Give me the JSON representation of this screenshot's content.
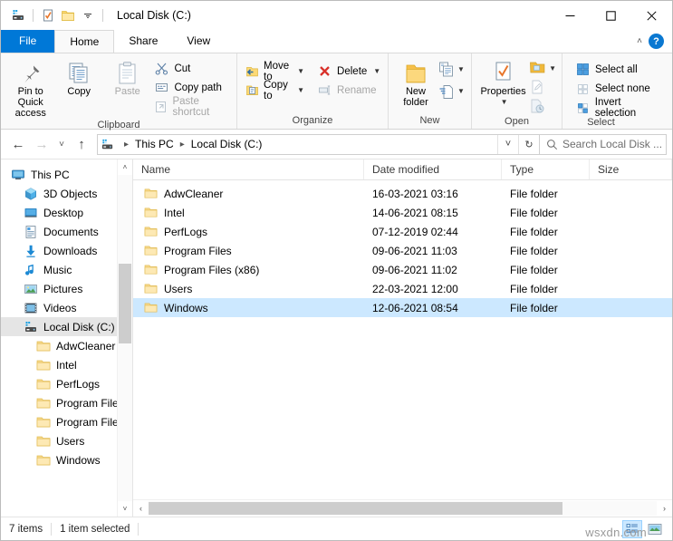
{
  "window": {
    "title": "Local Disk (C:)",
    "controls": {
      "minimize": "—",
      "maximize": "☐",
      "close": "✕"
    },
    "quick_access": [
      {
        "name": "drive-icon",
        "label": "Local Disk"
      },
      {
        "name": "properties-icon",
        "label": "Properties"
      },
      {
        "name": "new-folder-icon",
        "label": "New folder"
      },
      {
        "name": "chevron-down-icon",
        "label": "Customize Quick Access Toolbar"
      }
    ]
  },
  "tabs": [
    {
      "label": "File",
      "state": "file"
    },
    {
      "label": "Home",
      "state": "active"
    },
    {
      "label": "Share",
      "state": "normal"
    },
    {
      "label": "View",
      "state": "normal"
    }
  ],
  "tab_right": {
    "collapse": "˄",
    "help": "?"
  },
  "ribbon": {
    "groups": [
      {
        "label": "Clipboard",
        "big": [
          {
            "label_line1": "Pin to Quick",
            "label_line2": "access",
            "icon": "pin-icon",
            "dim": false
          },
          {
            "label_line1": "Copy",
            "label_line2": "",
            "icon": "copy-icon",
            "dim": false
          },
          {
            "label_line1": "Paste",
            "label_line2": "",
            "icon": "paste-icon",
            "dim": true
          }
        ],
        "small": [
          {
            "label": "Cut",
            "icon": "scissors-icon",
            "dim": false
          },
          {
            "label": "Copy path",
            "icon": "copy-path-icon",
            "dim": false
          },
          {
            "label": "Paste shortcut",
            "icon": "paste-shortcut-icon",
            "dim": true
          }
        ]
      },
      {
        "label": "Organize",
        "small_a": [
          {
            "label": "Move to",
            "icon": "move-to-icon",
            "caret": true,
            "dim": false
          },
          {
            "label": "Copy to",
            "icon": "copy-to-icon",
            "caret": true,
            "dim": false
          }
        ],
        "small_b": [
          {
            "label": "Delete",
            "icon": "delete-icon",
            "caret": true,
            "dim": false
          },
          {
            "label": "Rename",
            "icon": "rename-icon",
            "caret": false,
            "dim": true
          }
        ]
      },
      {
        "label": "New",
        "big": [
          {
            "label_line1": "New",
            "label_line2": "folder",
            "icon": "new-folder-icon",
            "dim": false
          }
        ],
        "stack": [
          {
            "icon": "new-item-icon",
            "caret": true
          },
          {
            "icon": "easy-access-icon",
            "caret": true
          }
        ]
      },
      {
        "label": "Open",
        "big": [
          {
            "label_line1": "Properties",
            "label_line2": "",
            "icon": "properties-icon",
            "caret": true,
            "dim": false
          }
        ],
        "stack": [
          {
            "icon": "open-icon",
            "caret": true
          },
          {
            "icon": "edit-icon",
            "caret": false,
            "dim": true
          },
          {
            "icon": "history-icon",
            "caret": false,
            "dim": true
          }
        ]
      },
      {
        "label": "Select",
        "small": [
          {
            "label": "Select all",
            "icon": "select-all-icon",
            "dim": false
          },
          {
            "label": "Select none",
            "icon": "select-none-icon",
            "dim": false
          },
          {
            "label": "Invert selection",
            "icon": "invert-selection-icon",
            "dim": false
          }
        ]
      }
    ]
  },
  "addressbar": {
    "back": "←",
    "forward": "→",
    "recent": "˅",
    "up": "↑",
    "breadcrumbs": [
      "This PC",
      "Local Disk (C:)"
    ],
    "dropdown": "˅",
    "refresh": "↻",
    "search_placeholder": "Search Local Disk ..."
  },
  "nav_pane": {
    "items": [
      {
        "label": "This PC",
        "icon": "this-pc-icon",
        "indent": 0,
        "selected": false
      },
      {
        "label": "3D Objects",
        "icon": "3d-objects-icon",
        "indent": 1,
        "selected": false
      },
      {
        "label": "Desktop",
        "icon": "desktop-icon",
        "indent": 1,
        "selected": false
      },
      {
        "label": "Documents",
        "icon": "documents-icon",
        "indent": 1,
        "selected": false
      },
      {
        "label": "Downloads",
        "icon": "downloads-icon",
        "indent": 1,
        "selected": false
      },
      {
        "label": "Music",
        "icon": "music-icon",
        "indent": 1,
        "selected": false
      },
      {
        "label": "Pictures",
        "icon": "pictures-icon",
        "indent": 1,
        "selected": false
      },
      {
        "label": "Videos",
        "icon": "videos-icon",
        "indent": 1,
        "selected": false
      },
      {
        "label": "Local Disk (C:)",
        "icon": "drive-icon",
        "indent": 1,
        "selected": true
      },
      {
        "label": "AdwCleaner",
        "icon": "folder-icon",
        "indent": 2,
        "selected": false
      },
      {
        "label": "Intel",
        "icon": "folder-icon",
        "indent": 2,
        "selected": false
      },
      {
        "label": "PerfLogs",
        "icon": "folder-icon",
        "indent": 2,
        "selected": false
      },
      {
        "label": "Program Files",
        "icon": "folder-icon",
        "indent": 2,
        "selected": false
      },
      {
        "label": "Program Files (",
        "icon": "folder-icon",
        "indent": 2,
        "selected": false
      },
      {
        "label": "Users",
        "icon": "folder-icon",
        "indent": 2,
        "selected": false
      },
      {
        "label": "Windows",
        "icon": "folder-icon",
        "indent": 2,
        "selected": false
      }
    ],
    "scroll": {
      "up": "˄",
      "down": "˅"
    }
  },
  "file_list": {
    "columns": [
      "Name",
      "Date modified",
      "Type",
      "Size"
    ],
    "rows": [
      {
        "name": "AdwCleaner",
        "date": "16-03-2021 03:16",
        "type": "File folder",
        "size": "",
        "selected": false
      },
      {
        "name": "Intel",
        "date": "14-06-2021 08:15",
        "type": "File folder",
        "size": "",
        "selected": false
      },
      {
        "name": "PerfLogs",
        "date": "07-12-2019 02:44",
        "type": "File folder",
        "size": "",
        "selected": false
      },
      {
        "name": "Program Files",
        "date": "09-06-2021 11:03",
        "type": "File folder",
        "size": "",
        "selected": false
      },
      {
        "name": "Program Files (x86)",
        "date": "09-06-2021 11:02",
        "type": "File folder",
        "size": "",
        "selected": false
      },
      {
        "name": "Users",
        "date": "22-03-2021 12:00",
        "type": "File folder",
        "size": "",
        "selected": false
      },
      {
        "name": "Windows",
        "date": "12-06-2021 08:54",
        "type": "File folder",
        "size": "",
        "selected": true
      }
    ],
    "hscroll": {
      "left": "‹",
      "right": "›"
    }
  },
  "status": {
    "item_count": "7 items",
    "selection": "1 item selected",
    "views": [
      {
        "name": "details-view-button",
        "active": true
      },
      {
        "name": "large-icons-view-button",
        "active": false
      }
    ]
  },
  "watermark": "wsxdn.com",
  "colors": {
    "accent": "#0078d7",
    "selection": "#cce8ff",
    "folder_yellow": "#ffd966",
    "tree_selected": "#e5e5e5"
  }
}
